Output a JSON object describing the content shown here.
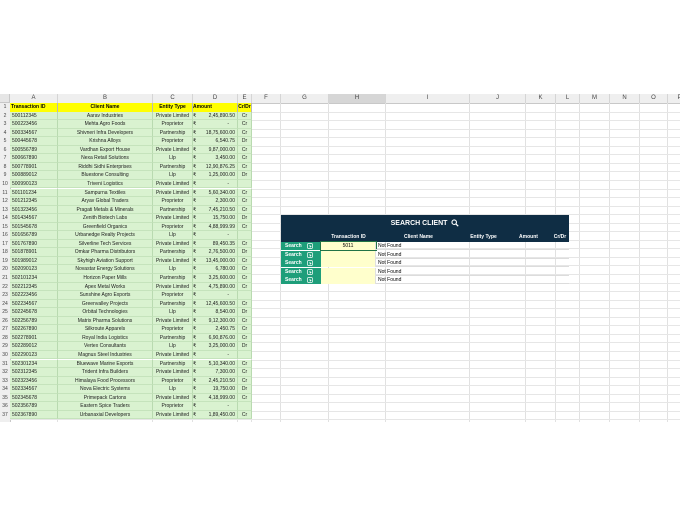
{
  "columns": [
    "A",
    "B",
    "C",
    "D",
    "E",
    "F",
    "G",
    "H",
    "I",
    "J",
    "K",
    "L",
    "M",
    "N",
    "O",
    "P"
  ],
  "table": {
    "headers": {
      "a": "Transaction ID",
      "b": "Client Name",
      "c": "Entity Type",
      "d": "Amount",
      "e": "Cr/Dr"
    },
    "currency": "₹",
    "rows": [
      [
        "500112345",
        "Aarav Industries",
        "Private Limited",
        "2,45,890.50",
        "Cr"
      ],
      [
        "500223456",
        "Mehta Agro Foods",
        "Proprietor",
        "",
        "Cr"
      ],
      [
        "500334567",
        "Shivneri Infra Developers",
        "Partnership",
        "18,75,600.00",
        "Cr"
      ],
      [
        "500445678",
        "Krishna Alloys",
        "Proprietor",
        "6,540.75",
        "Dr"
      ],
      [
        "500556789",
        "Vardhan Export House",
        "Private Limited",
        "9,87,000.00",
        "Cr"
      ],
      [
        "500667890",
        "Nexa Retail Solutions",
        "Llp",
        "3,450.00",
        "Cr"
      ],
      [
        "500778901",
        "Riddhi Sidhi Enterprises",
        "Partnership",
        "12,90,876.25",
        "Cr"
      ],
      [
        "500889012",
        "Bluestone Consulting",
        "Llp",
        "1,25,000.00",
        "Dr"
      ],
      [
        "500990123",
        "Triveni Logistics",
        "Private Limited",
        "",
        ""
      ],
      [
        "501101234",
        "Sampurna Textiles",
        "Private Limited",
        "5,60,340.00",
        "Cr"
      ],
      [
        "501212345",
        "Aryav Global Traders",
        "Proprietor",
        "2,300.00",
        "Cr"
      ],
      [
        "501323456",
        "Pragati Metals & Minerals",
        "Partnership",
        "7,45,210.50",
        "Cr"
      ],
      [
        "501434567",
        "Zenith Biotech Labs",
        "Private Limited",
        "15,750.00",
        "Dr"
      ],
      [
        "501545678",
        "Greenfield Organics",
        "Proprietor",
        "4,88,999.99",
        "Cr"
      ],
      [
        "501656789",
        "Urbanedge Realty Projects",
        "Llp",
        "",
        ""
      ],
      [
        "501767890",
        "Silverline Tech Services",
        "Private Limited",
        "89,450.35",
        "Cr"
      ],
      [
        "501878901",
        "Omkar Pharma Distributors",
        "Partnership",
        "2,76,500.00",
        "Dr"
      ],
      [
        "501989012",
        "Skyhigh Aviation Support",
        "Private Limited",
        "13,45,000.00",
        "Cr"
      ],
      [
        "502090123",
        "Novastar Energy Solutions",
        "Llp",
        "6,780.00",
        "Cr"
      ],
      [
        "502101234",
        "Horizon Paper Mills",
        "Partnership",
        "3,25,600.00",
        "Cr"
      ],
      [
        "502212345",
        "Apex Metal Works",
        "Private Limited",
        "4,75,890.00",
        "Cr"
      ],
      [
        "502223456",
        "Sunshine Agro Exports",
        "Proprietor",
        "",
        ""
      ],
      [
        "502234567",
        "Greenvalley Projects",
        "Partnership",
        "12,45,600.50",
        "Cr"
      ],
      [
        "502245678",
        "Orbital Technologies",
        "Llp",
        "8,540.00",
        "Dr"
      ],
      [
        "502256789",
        "Matrix Pharma Solutions",
        "Private Limited",
        "9,12,300.00",
        "Cr"
      ],
      [
        "502267890",
        "Silkroute Apparels",
        "Proprietor",
        "2,450.75",
        "Cr"
      ],
      [
        "502278901",
        "Royal India Logistics",
        "Partnership",
        "6,90,876.00",
        "Cr"
      ],
      [
        "502289012",
        "Vertex Consultants",
        "Llp",
        "3,25,000.00",
        "Dr"
      ],
      [
        "502290123",
        "Magnus Steel Industries",
        "Private Limited",
        "",
        ""
      ],
      [
        "502301234",
        "Bluewave Marine Exports",
        "Partnership",
        "5,10,340.00",
        "Cr"
      ],
      [
        "502312345",
        "Trident Infra Builders",
        "Private Limited",
        "7,300.00",
        "Cr"
      ],
      [
        "502323456",
        "Himalaya Food Processors",
        "Proprietor",
        "2,45,210.50",
        "Cr"
      ],
      [
        "502334567",
        "Nova Electric Systems",
        "Llp",
        "19,750.00",
        "Dr"
      ],
      [
        "502345678",
        "Primepack Cartons",
        "Private Limited",
        "4,18,999.00",
        "Cr"
      ],
      [
        "502356789",
        "Eastern Spice Traders",
        "Proprietor",
        "",
        ""
      ],
      [
        "502367890",
        "Urbanaxial Developers",
        "Private Limited",
        "1,89,450.00",
        "Cr"
      ]
    ]
  },
  "search": {
    "banner": "SEARCH CLIENT",
    "headers": {
      "id": "Transaction ID",
      "name": "Client Name",
      "type": "Entity Type",
      "amount": "Amount",
      "crdr": "Cr/Dr"
    },
    "button_label": "Search",
    "rows": [
      {
        "id": "5011",
        "result": "Not Found"
      },
      {
        "id": "",
        "result": "Not Found"
      },
      {
        "id": "",
        "result": "Not Found"
      },
      {
        "id": "",
        "result": "Not Found"
      },
      {
        "id": "",
        "result": "Not Found"
      }
    ]
  },
  "colors": {
    "accent": "#0f2d44",
    "button": "#1e9e7a",
    "table_fill": "#d9f2d0",
    "header_fill": "#ffff00"
  }
}
